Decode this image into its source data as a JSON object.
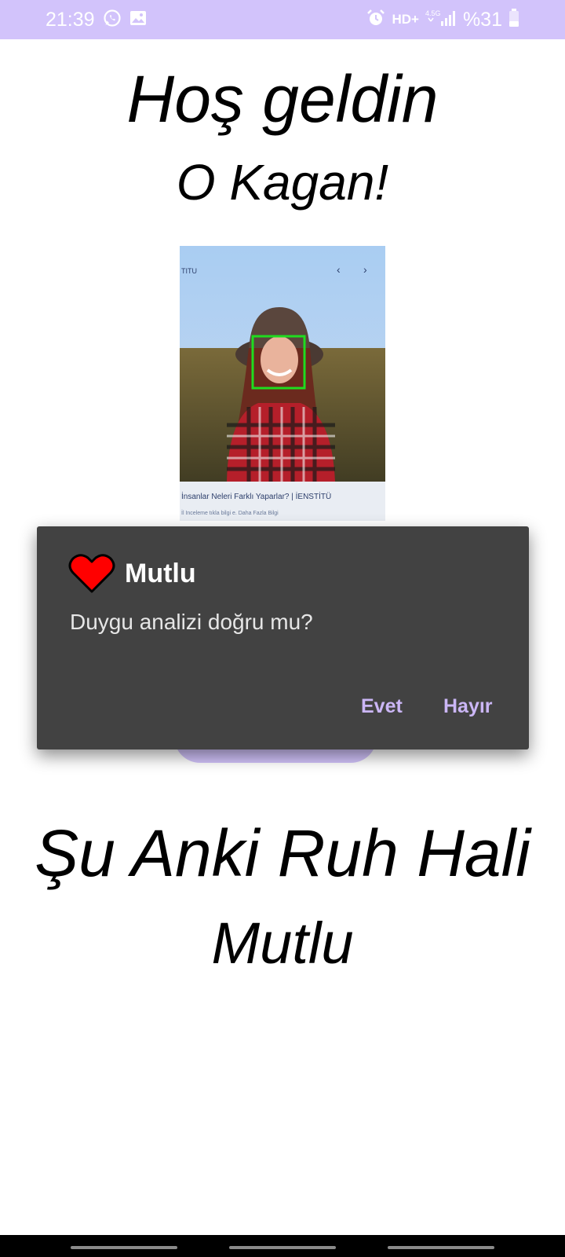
{
  "status_bar": {
    "time": "21:39",
    "network": "HD+",
    "network_gen": "4.5G",
    "battery": "%31",
    "left_icons": [
      "whatsapp-icon",
      "gallery-icon"
    ],
    "right_icons": [
      "alarm-icon",
      "signal-icon",
      "battery-icon"
    ],
    "background": "#d2c3fb"
  },
  "header": {
    "welcome": "Hoş geldin",
    "username": "O Kagan!"
  },
  "photo": {
    "top_text": "TITU",
    "caption": "İnsanlar Neleri Farklı Yaparlar? | İENSTİTÜ",
    "subcaption": "İl Inceleme tıkla bilgi e. Daha Fazla Bilgi",
    "face_box_color": "#1fdc1f"
  },
  "mood": {
    "heading": "Şu Anki Ruh Hali",
    "value": "Mutlu"
  },
  "dialog": {
    "title": "Mutlu",
    "icon": "heart-icon",
    "icon_color": "#ff0000",
    "message": "Duygu analizi doğru mu?",
    "positive_label": "Evet",
    "negative_label": "Hayır",
    "button_color": "#cbb6f6"
  }
}
